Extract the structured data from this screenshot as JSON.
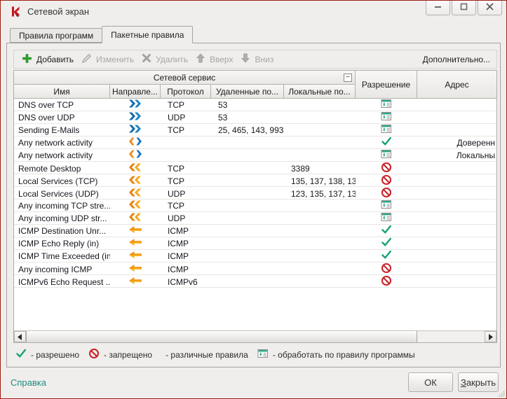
{
  "window": {
    "title": "Сетевой экран",
    "controls": [
      {
        "icon": "minimize-icon"
      },
      {
        "icon": "maximize-icon"
      },
      {
        "icon": "close-icon"
      }
    ]
  },
  "tabs": [
    {
      "label": "Правила программ",
      "active": false
    },
    {
      "label": "Пакетные правила",
      "active": true
    }
  ],
  "toolbar": {
    "items": [
      {
        "label": "Добавить",
        "icon": "add-icon",
        "enabled": true
      },
      {
        "label": "Изменить",
        "icon": "edit-icon",
        "enabled": false
      },
      {
        "label": "Удалить",
        "icon": "delete-icon",
        "enabled": false
      },
      {
        "label": "Вверх",
        "icon": "up-arrow-icon",
        "enabled": false
      },
      {
        "label": "Вниз",
        "icon": "down-arrow-icon",
        "enabled": false
      }
    ],
    "more_label": "Дополнительно..."
  },
  "table": {
    "group_header": "Сетевой сервис",
    "collapse_glyph": "−",
    "columns": {
      "name": "Имя",
      "direction": "Направле...",
      "protocol": "Протокол",
      "remote_ports": "Удаленные по...",
      "local_ports": "Локальные по...",
      "permission": "Разрешение",
      "address": "Адрес"
    },
    "rows": [
      {
        "name": "DNS over TCP",
        "direction": "direction-out-icon",
        "protocol": "TCP",
        "remote_ports": "53",
        "local_ports": "",
        "permission": "app-rule-icon",
        "address": ""
      },
      {
        "name": "DNS over UDP",
        "direction": "direction-out-icon",
        "protocol": "UDP",
        "remote_ports": "53",
        "local_ports": "",
        "permission": "app-rule-icon",
        "address": ""
      },
      {
        "name": "Sending E-Mails",
        "direction": "direction-out-icon",
        "protocol": "TCP",
        "remote_ports": "25, 465, 143, 993",
        "local_ports": "",
        "permission": "app-rule-icon",
        "address": ""
      },
      {
        "name": "Any network activity",
        "direction": "direction-inout-icon",
        "protocol": "",
        "remote_ports": "",
        "local_ports": "",
        "permission": "allow-check-icon",
        "address": "Доверенн"
      },
      {
        "name": "Any network activity",
        "direction": "direction-inout-icon",
        "protocol": "",
        "remote_ports": "",
        "local_ports": "",
        "permission": "app-rule-icon",
        "address": "Локальны"
      },
      {
        "name": "Remote Desktop",
        "direction": "direction-in-double-icon",
        "protocol": "TCP",
        "remote_ports": "",
        "local_ports": "3389",
        "permission": "block-icon",
        "address": ""
      },
      {
        "name": "Local Services (TCP)",
        "direction": "direction-in-double-icon",
        "protocol": "TCP",
        "remote_ports": "",
        "local_ports": "135, 137, 138, 13...",
        "permission": "block-icon",
        "address": ""
      },
      {
        "name": "Local Services (UDP)",
        "direction": "direction-in-double-icon",
        "protocol": "UDP",
        "remote_ports": "",
        "local_ports": "123, 135, 137, 13...",
        "permission": "block-icon",
        "address": ""
      },
      {
        "name": "Any incoming TCP stre...",
        "direction": "direction-in-double-icon",
        "protocol": "TCP",
        "remote_ports": "",
        "local_ports": "",
        "permission": "app-rule-icon",
        "address": ""
      },
      {
        "name": "Any incoming UDP str...",
        "direction": "direction-in-double-icon",
        "protocol": "UDP",
        "remote_ports": "",
        "local_ports": "",
        "permission": "app-rule-icon",
        "address": ""
      },
      {
        "name": "ICMP Destination Unr...",
        "direction": "direction-in-icon",
        "protocol": "ICMP",
        "remote_ports": "",
        "local_ports": "",
        "permission": "allow-check-icon",
        "address": ""
      },
      {
        "name": "ICMP Echo Reply (in)",
        "direction": "direction-in-icon",
        "protocol": "ICMP",
        "remote_ports": "",
        "local_ports": "",
        "permission": "allow-check-icon",
        "address": ""
      },
      {
        "name": "ICMP Time Exceeded (in)",
        "direction": "direction-in-icon",
        "protocol": "ICMP",
        "remote_ports": "",
        "local_ports": "",
        "permission": "allow-check-icon",
        "address": ""
      },
      {
        "name": "Any incoming ICMP",
        "direction": "direction-in-icon",
        "protocol": "ICMP",
        "remote_ports": "",
        "local_ports": "",
        "permission": "block-icon",
        "address": ""
      },
      {
        "name": "ICMPv6 Echo Request ...",
        "direction": "direction-in-icon",
        "protocol": "ICMPv6",
        "remote_ports": "",
        "local_ports": "",
        "permission": "block-icon",
        "address": ""
      }
    ]
  },
  "legend": [
    {
      "icon": "allow-check-icon",
      "label": "- разрешено"
    },
    {
      "icon": "block-icon",
      "label": "- запрещено"
    },
    {
      "icon": "mixed-rules-pie-icon",
      "label": "- различные правила"
    },
    {
      "icon": "app-rule-icon",
      "label": "- обработать по правилу программы"
    }
  ],
  "footer": {
    "help_label": "Справка",
    "ok_label": "ОК",
    "close_label": "Закрыть"
  },
  "colors": {
    "accent_red_border": "#9b2015",
    "allow_green": "#17a076",
    "block_red": "#c8242b",
    "app_rule_teal": "#25a285",
    "outbound_blue": "#1769ae",
    "inbound_orange": "#ee8a10",
    "help_link_teal": "#1f8b80"
  }
}
